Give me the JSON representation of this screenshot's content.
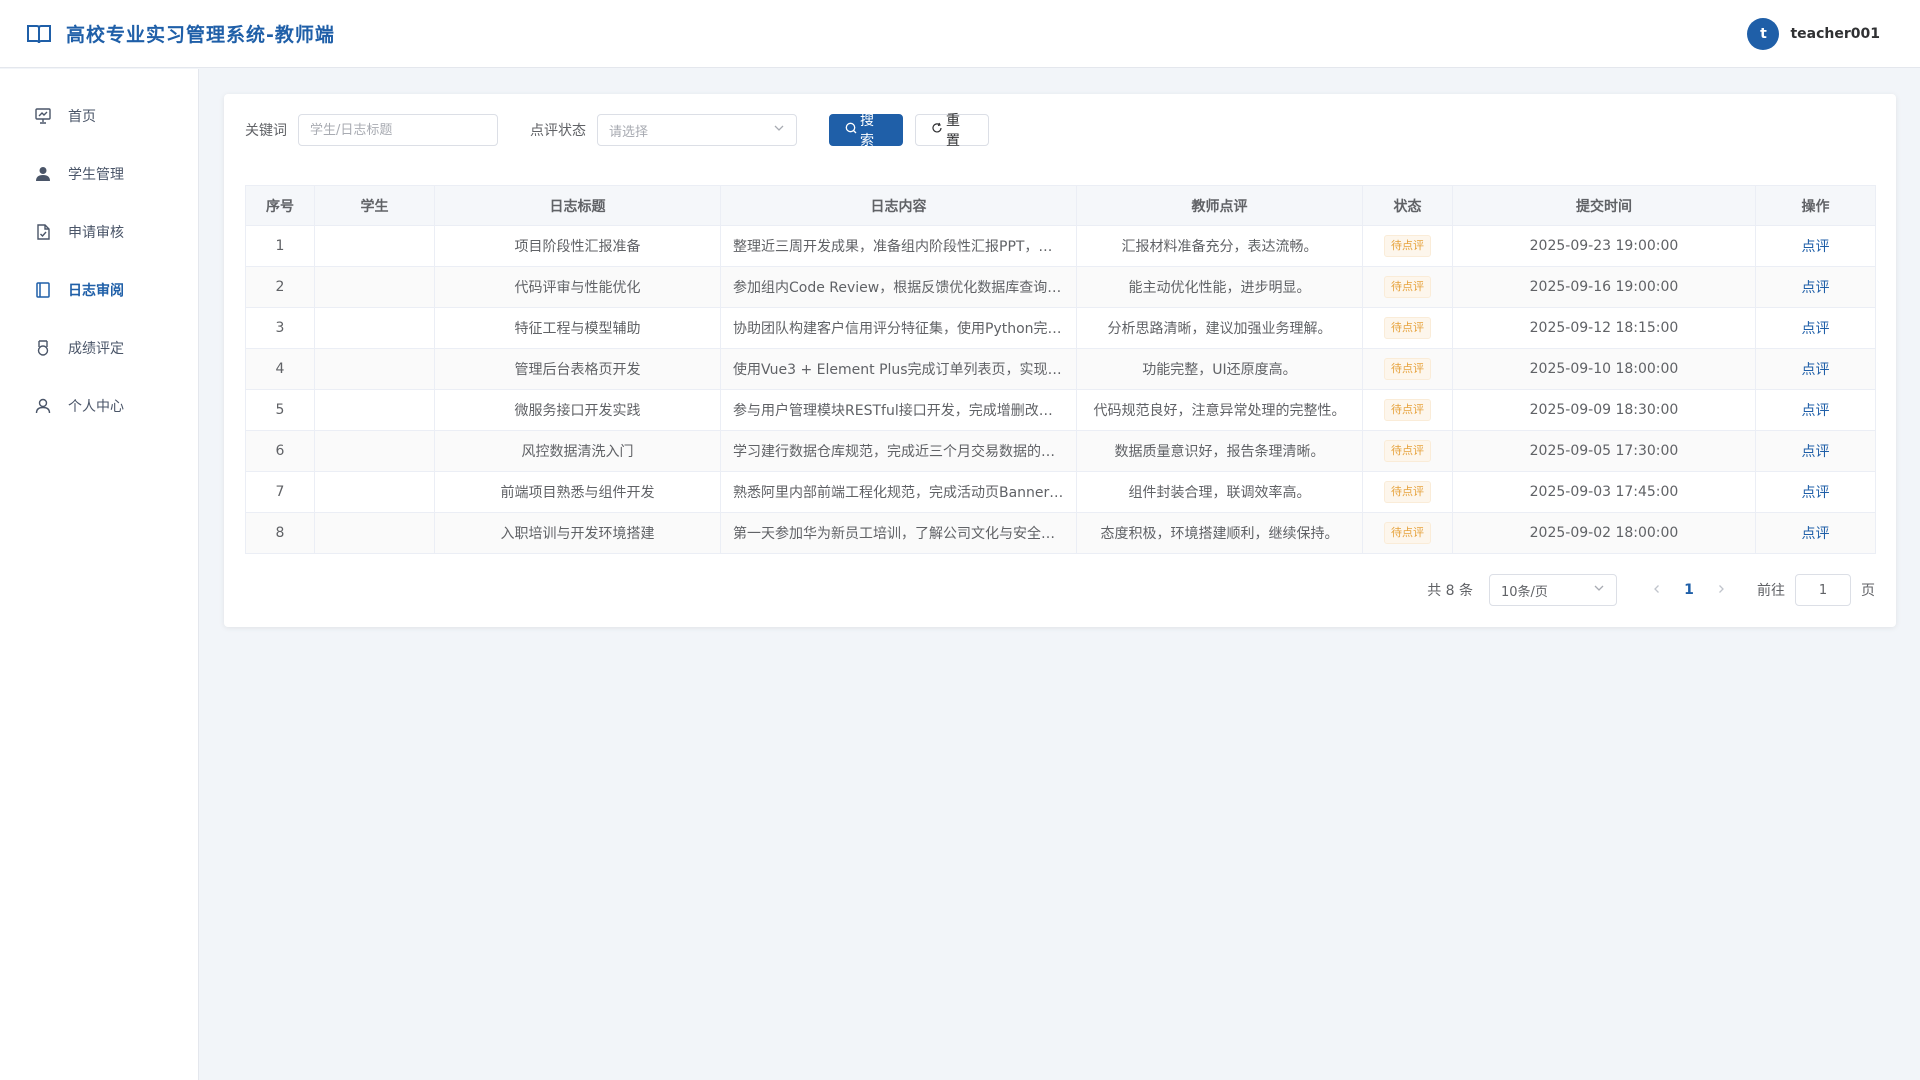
{
  "header": {
    "title": "高校专业实习管理系统-教师端",
    "user_initial": "t",
    "username": "teacher001"
  },
  "sidebar": {
    "items": [
      {
        "label": "首页",
        "icon": "dashboard-icon",
        "active": false
      },
      {
        "label": "学生管理",
        "icon": "user-icon",
        "active": false
      },
      {
        "label": "申请审核",
        "icon": "document-check-icon",
        "active": false
      },
      {
        "label": "日志审阅",
        "icon": "notebook-icon",
        "active": true
      },
      {
        "label": "成绩评定",
        "icon": "medal-icon",
        "active": false
      },
      {
        "label": "个人中心",
        "icon": "person-outline-icon",
        "active": false
      }
    ]
  },
  "filters": {
    "keyword_label": "关键词",
    "keyword_placeholder": "学生/日志标题",
    "status_label": "点评状态",
    "status_placeholder": "请选择",
    "search_button": "搜索",
    "reset_button": "重置"
  },
  "table": {
    "columns": [
      "序号",
      "学生",
      "日志标题",
      "日志内容",
      "教师点评",
      "状态",
      "提交时间",
      "操作"
    ],
    "rows": [
      {
        "index": "1",
        "student": "",
        "title": "项目阶段性汇报准备",
        "content": "整理近三周开发成果，准备组内阶段性汇报PPT，…",
        "comment": "汇报材料准备充分，表达流畅。",
        "status": "待点评",
        "time": "2025-09-23 19:00:00",
        "action": "点评"
      },
      {
        "index": "2",
        "student": "",
        "title": "代码评审与性能优化",
        "content": "参加组内Code Review，根据反馈优化数据库查询…",
        "comment": "能主动优化性能，进步明显。",
        "status": "待点评",
        "time": "2025-09-16 19:00:00",
        "action": "点评"
      },
      {
        "index": "3",
        "student": "",
        "title": "特征工程与模型辅助",
        "content": "协助团队构建客户信用评分特征集，使用Python完…",
        "comment": "分析思路清晰，建议加强业务理解。",
        "status": "待点评",
        "time": "2025-09-12 18:15:00",
        "action": "点评"
      },
      {
        "index": "4",
        "student": "",
        "title": "管理后台表格页开发",
        "content": "使用Vue3 + Element Plus完成订单列表页，实现分…",
        "comment": "功能完整，UI还原度高。",
        "status": "待点评",
        "time": "2025-09-10 18:00:00",
        "action": "点评"
      },
      {
        "index": "5",
        "student": "",
        "title": "微服务接口开发实践",
        "content": "参与用户管理模块RESTful接口开发，完成增删改…",
        "comment": "代码规范良好，注意异常处理的完整性。",
        "status": "待点评",
        "time": "2025-09-09 18:30:00",
        "action": "点评"
      },
      {
        "index": "6",
        "student": "",
        "title": "风控数据清洗入门",
        "content": "学习建行数据仓库规范，完成近三个月交易数据的…",
        "comment": "数据质量意识好，报告条理清晰。",
        "status": "待点评",
        "time": "2025-09-05 17:30:00",
        "action": "点评"
      },
      {
        "index": "7",
        "student": "",
        "title": "前端项目熟悉与组件开发",
        "content": "熟悉阿里内部前端工程化规范，完成活动页Banner…",
        "comment": "组件封装合理，联调效率高。",
        "status": "待点评",
        "time": "2025-09-03 17:45:00",
        "action": "点评"
      },
      {
        "index": "8",
        "student": "",
        "title": "入职培训与开发环境搭建",
        "content": "第一天参加华为新员工培训，了解公司文化与安全…",
        "comment": "态度积极，环境搭建顺利，继续保持。",
        "status": "待点评",
        "time": "2025-09-02 18:00:00",
        "action": "点评"
      }
    ]
  },
  "pagination": {
    "total_text": "共 8 条",
    "page_size": "10条/页",
    "current_page": "1",
    "goto_label": "前往",
    "goto_value": "1",
    "page_suffix": "页"
  },
  "colors": {
    "primary": "#1f5fa8",
    "warning_tag": "#e6a23c"
  }
}
